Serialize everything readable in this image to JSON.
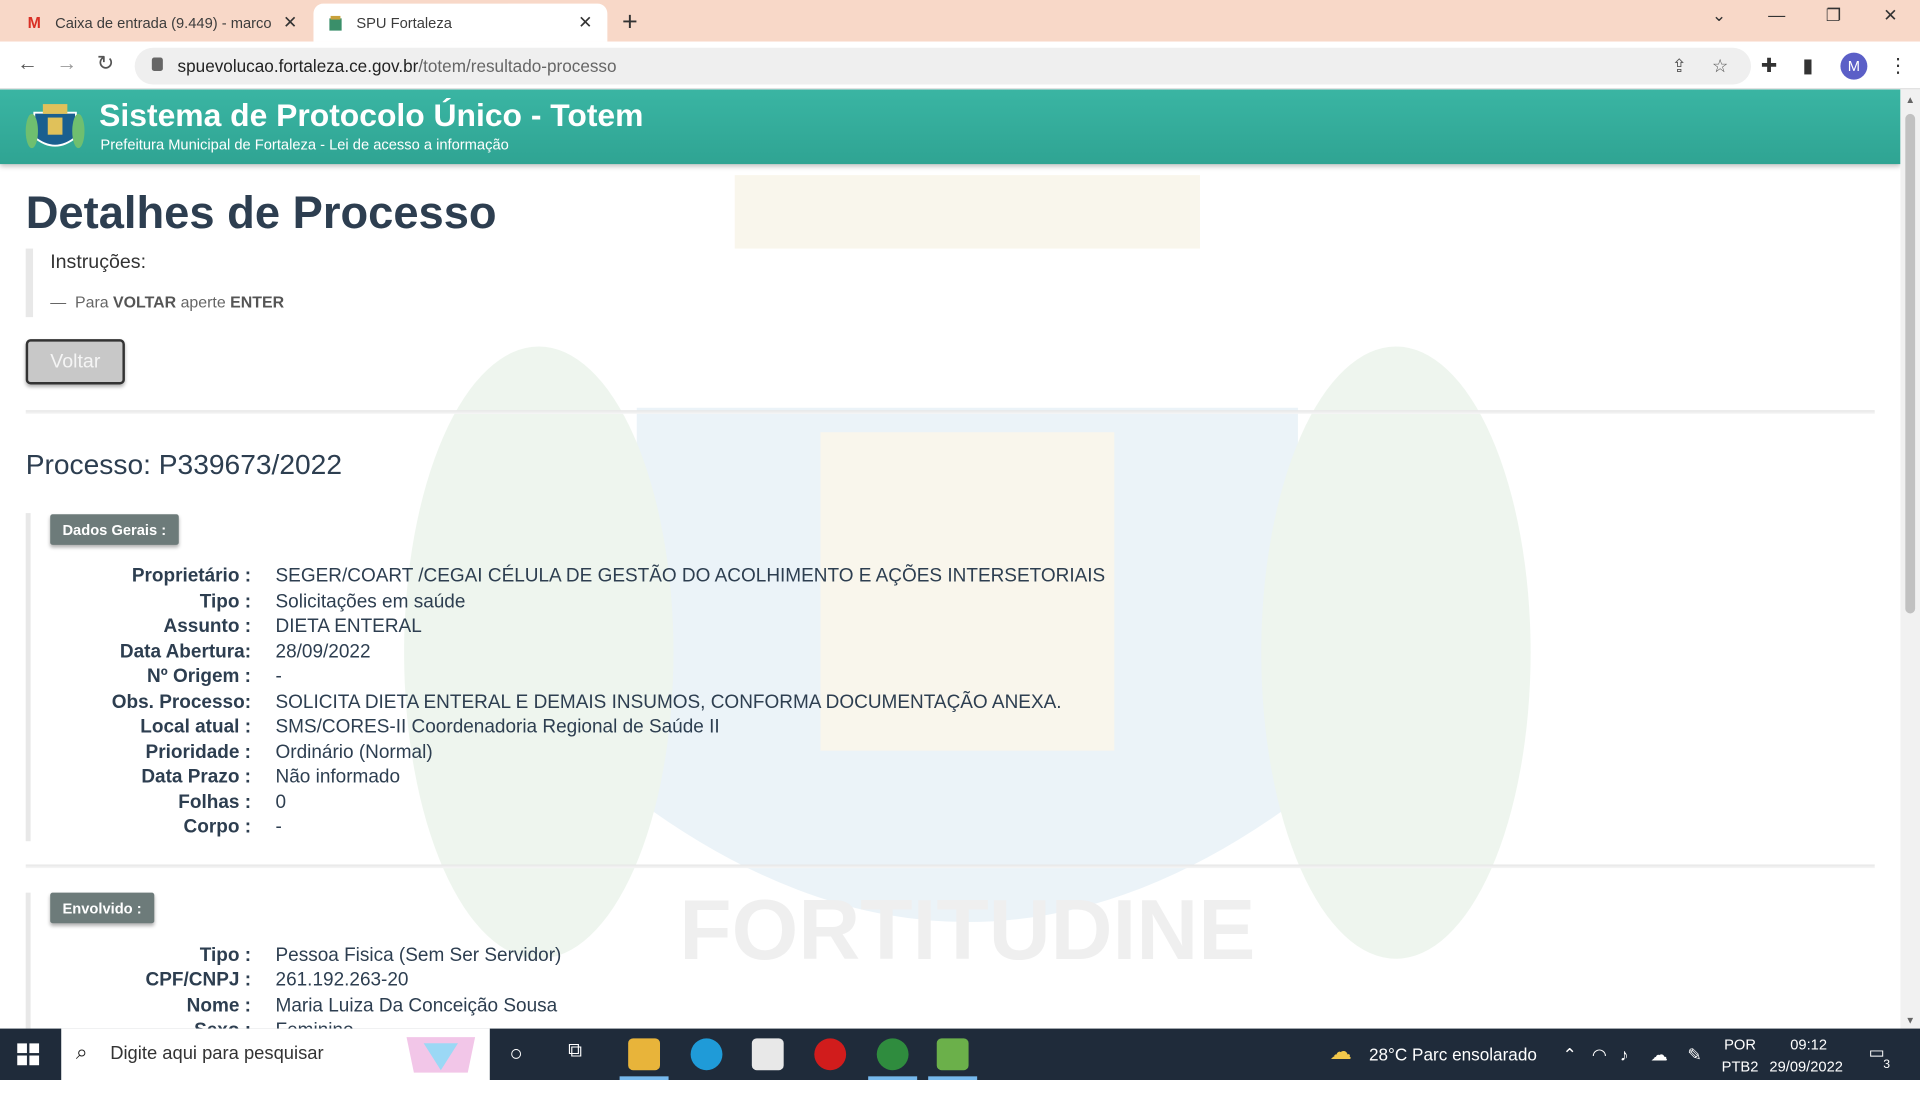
{
  "browser": {
    "tabs": [
      {
        "title": "Caixa de entrada (9.449) - marco",
        "icon": "gmail-icon",
        "active": false
      },
      {
        "title": "SPU Fortaleza",
        "icon": "fortaleza-crest-icon",
        "active": true
      }
    ],
    "url_host": "spuevolucao.fortaleza.ce.gov.br",
    "url_path": "/totem/resultado-processo",
    "profile_initial": "M"
  },
  "header": {
    "title": "Sistema de Protocolo Único - Totem",
    "subtitle": "Prefeitura Municipal de Fortaleza - Lei de acesso a informação"
  },
  "page": {
    "heading": "Detalhes de Processo",
    "instructions_title": "Instruções:",
    "instruction_dash": "—",
    "instruction_pre": "Para",
    "instruction_key1": "VOLTAR",
    "instruction_mid": "aperte",
    "instruction_key2": "ENTER",
    "back_button": "Voltar",
    "process_label": "Processo: P339673/2022",
    "watermark_text": "FORTITUDINE"
  },
  "dados_gerais": {
    "badge": "Dados Gerais :",
    "rows": [
      {
        "k": "Proprietário :",
        "v": "SEGER/COART /CEGAI CÉLULA DE GESTÃO DO ACOLHIMENTO E AÇÕES INTERSETORIAIS"
      },
      {
        "k": "Tipo :",
        "v": "Solicitações em saúde"
      },
      {
        "k": "Assunto :",
        "v": "DIETA ENTERAL"
      },
      {
        "k": "Data Abertura:",
        "v": "28/09/2022"
      },
      {
        "k": "Nº Origem :",
        "v": "-"
      },
      {
        "k": "Obs. Processo:",
        "v": "SOLICITA DIETA ENTERAL E DEMAIS INSUMOS, CONFORMA DOCUMENTAÇÃO ANEXA."
      },
      {
        "k": "Local atual :",
        "v": "SMS/CORES-II Coordenadoria Regional de Saúde II"
      },
      {
        "k": "Prioridade :",
        "v": "Ordinário (Normal)"
      },
      {
        "k": "Data Prazo :",
        "v": "Não informado"
      },
      {
        "k": "Folhas :",
        "v": "0"
      },
      {
        "k": "Corpo :",
        "v": "-"
      }
    ]
  },
  "envolvido": {
    "badge": "Envolvido :",
    "rows": [
      {
        "k": "Tipo :",
        "v": "Pessoa Fisica (Sem Ser Servidor)"
      },
      {
        "k": "CPF/CNPJ :",
        "v": "261.192.263-20"
      },
      {
        "k": "Nome :",
        "v": "Maria Luiza Da Conceição Sousa"
      },
      {
        "k": "Sexo :",
        "v": "Feminino"
      }
    ]
  },
  "taskbar": {
    "search_placeholder": "Digite aqui para pesquisar",
    "weather": "28°C  Parc ensolarado",
    "lang1": "POR",
    "lang2": "PTB2",
    "time": "09:12",
    "date": "29/09/2022",
    "notifications": "3"
  }
}
